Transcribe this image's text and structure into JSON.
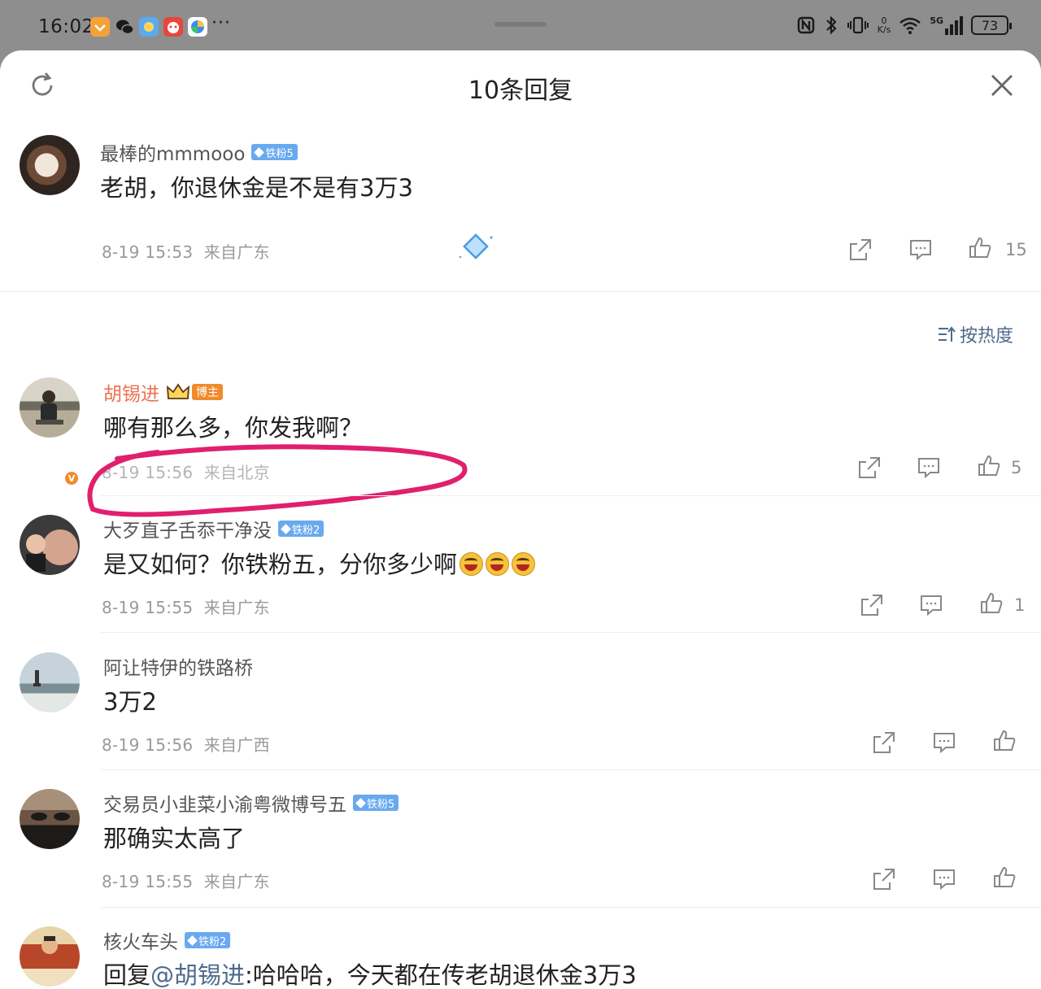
{
  "status": {
    "time": "16:02",
    "more": "···",
    "net_speed_value": "0",
    "net_speed_unit": "K/s",
    "network": "5G",
    "battery": "73"
  },
  "header": {
    "title": "10条回复",
    "refresh_icon": "refresh-icon",
    "close_icon": "close-icon"
  },
  "top_comment": {
    "username": "最棒的mmmooo",
    "badge": "铁粉5",
    "text": "老胡，你退休金是不是有3万3",
    "time": "8-19 15:53",
    "location": "来自广东",
    "likes": "15"
  },
  "sort_label": "按热度",
  "replies": [
    {
      "username": "胡锡进",
      "badge": "博主",
      "text": "哪有那么多，你发我啊？",
      "time": "8-19 15:56",
      "location": "来自北京",
      "likes": "5"
    },
    {
      "username": "大歹直子舌忝干净没",
      "badge": "铁粉2",
      "text": "是又如何？你铁粉五，分你多少啊",
      "time": "8-19 15:55",
      "location": "来自广东",
      "likes": "1"
    },
    {
      "username": "阿让特伊的铁路桥",
      "text": "3万2",
      "time": "8-19 15:56",
      "location": "来自广西"
    },
    {
      "username": "交易员小韭菜小渝粤微博号五",
      "badge": "铁粉5",
      "text": "那确实太高了",
      "time": "8-19 15:55",
      "location": "来自广东"
    },
    {
      "username": "核火车头",
      "badge": "铁粉2",
      "reply_prefix": "回复",
      "mention": "@胡锡进",
      "text": ":哈哈哈，今天都在传老胡退休金3万3"
    }
  ],
  "colors": {
    "accent_link": "#4e6a8c",
    "owner_name": "#eb7350",
    "fan_badge": "#69a9ef",
    "annotation": "#e0206e"
  }
}
